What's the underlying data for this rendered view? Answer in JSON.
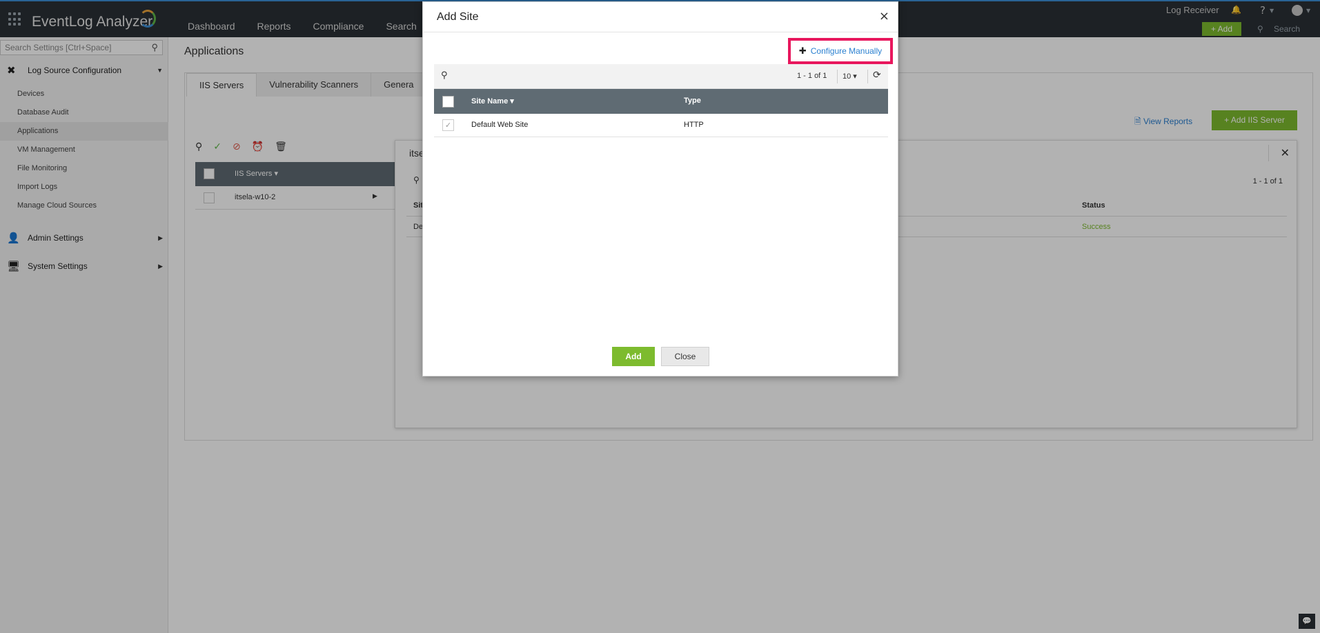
{
  "app": {
    "brand": "EventLog Analyzer",
    "nav": [
      "Dashboard",
      "Reports",
      "Compliance",
      "Search"
    ],
    "log_receiver": "Log Receiver",
    "help": "?",
    "add_label": "+ Add",
    "search_label": "Search"
  },
  "sidebar": {
    "search_placeholder": "Search Settings [Ctrl+Space]",
    "sections": {
      "log_source": "Log Source Configuration",
      "admin": "Admin Settings",
      "system": "System Settings"
    },
    "items": [
      "Devices",
      "Database Audit",
      "Applications",
      "VM Management",
      "File Monitoring",
      "Import Logs",
      "Manage Cloud Sources"
    ]
  },
  "main": {
    "title": "Applications",
    "tabs": [
      "IIS Servers",
      "Vulnerability Scanners",
      "Genera"
    ],
    "view_reports": "View Reports",
    "add_iis_server": "+ Add IIS Server",
    "iis_header": "IIS Servers",
    "iis_row": "itsela-w10-2"
  },
  "detail": {
    "title": "itse",
    "pagination": "1 - 1 of 1",
    "col_site": "Sit",
    "col_status": "Status",
    "row_site": "De",
    "row_status": "Success"
  },
  "modal": {
    "title": "Add Site",
    "close_glyph": "×",
    "configure_manually": "Configure Manually",
    "pagination": "1 - 1 of 1",
    "per_page": "10",
    "columns": {
      "site_name": "Site Name",
      "type": "Type"
    },
    "rows": [
      {
        "site_name": "Default Web Site",
        "type": "HTTP"
      }
    ],
    "add_button": "Add",
    "close_button": "Close"
  },
  "colors": {
    "accent_green": "#7dbb2e",
    "highlight_pink": "#e8175d",
    "link_blue": "#2a7fd0",
    "topbar": "#2a3035"
  }
}
